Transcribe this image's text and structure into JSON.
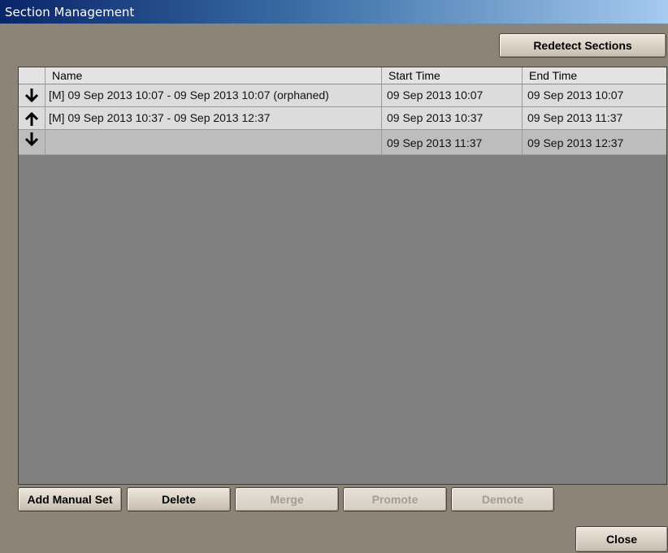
{
  "window": {
    "title": "Section Management"
  },
  "toolbar": {
    "redetect_label": "Redetect Sections"
  },
  "table": {
    "columns": [
      "",
      "Name",
      "Start Time",
      "End Time"
    ],
    "rows": [
      {
        "icon": "arrow-down-icon",
        "name": "[M] 09 Sep 2013 10:07 - 09 Sep 2013 10:07 (orphaned)",
        "start": "09 Sep 2013 10:07",
        "end": "09 Sep 2013 10:07"
      },
      {
        "icon": "arrow-up-icon",
        "name": "[M] 09 Sep 2013 10:37 - 09 Sep 2013 12:37",
        "start": "09 Sep 2013 10:37",
        "end": "09 Sep 2013 11:37"
      },
      {
        "icon": "arrow-down-icon",
        "name": "",
        "start": "09 Sep 2013 11:37",
        "end": "09 Sep 2013 12:37"
      }
    ]
  },
  "actions": {
    "add_manual_set": "Add Manual Set",
    "delete": "Delete",
    "merge": "Merge",
    "promote": "Promote",
    "demote": "Demote",
    "close": "Close"
  }
}
